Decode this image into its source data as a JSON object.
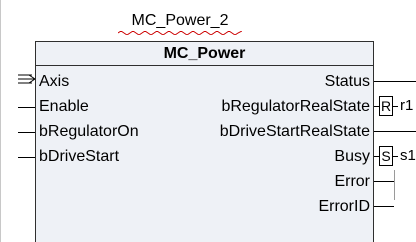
{
  "instance": {
    "name": "MC_Power_2"
  },
  "block": {
    "type_name": "MC_Power",
    "inputs": [
      {
        "label": "Axis"
      },
      {
        "label": "Enable"
      },
      {
        "label": "bRegulatorOn"
      },
      {
        "label": "bDriveStart"
      }
    ],
    "outputs": [
      {
        "label": "Status"
      },
      {
        "label": "bRegulatorRealState"
      },
      {
        "label": "bDriveStartRealState"
      },
      {
        "label": "Busy"
      },
      {
        "label": "Error"
      },
      {
        "label": "ErrorID"
      }
    ]
  },
  "connections": {
    "reset_coil_label": "R",
    "reset_var": "r1",
    "set_coil_label": "S",
    "set_var": "s1"
  },
  "colors": {
    "block_fill": "#eef1f6",
    "outline": "#2f2f2f",
    "squiggle": "#cc0000"
  },
  "icons": {
    "axis_input": "reference-arrow-icon"
  }
}
